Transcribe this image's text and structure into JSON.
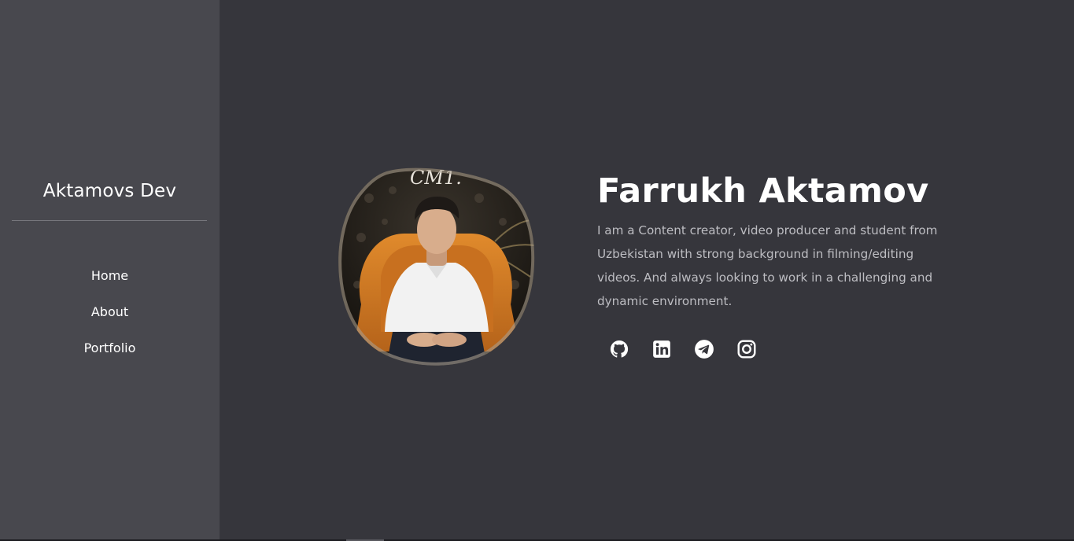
{
  "sidebar": {
    "brand": "Aktamovs Dev",
    "nav": [
      {
        "label": "Home"
      },
      {
        "label": "About"
      },
      {
        "label": "Portfolio"
      }
    ]
  },
  "hero": {
    "name": "Farrukh Aktamov",
    "bio": "I am a Content creator, video producer and student from Uzbekistan with strong background in filming/editing videos. And always looking to work in a challenging and dynamic environment.",
    "photo_sign_text": "CM1.",
    "socials": [
      {
        "icon": "github-icon"
      },
      {
        "icon": "linkedin-icon"
      },
      {
        "icon": "telegram-icon"
      },
      {
        "icon": "instagram-icon"
      }
    ]
  },
  "colors": {
    "background": "#36363c",
    "sidebar": "#48484e",
    "text": "#ffffff",
    "muted_text": "#bdbdc2"
  }
}
